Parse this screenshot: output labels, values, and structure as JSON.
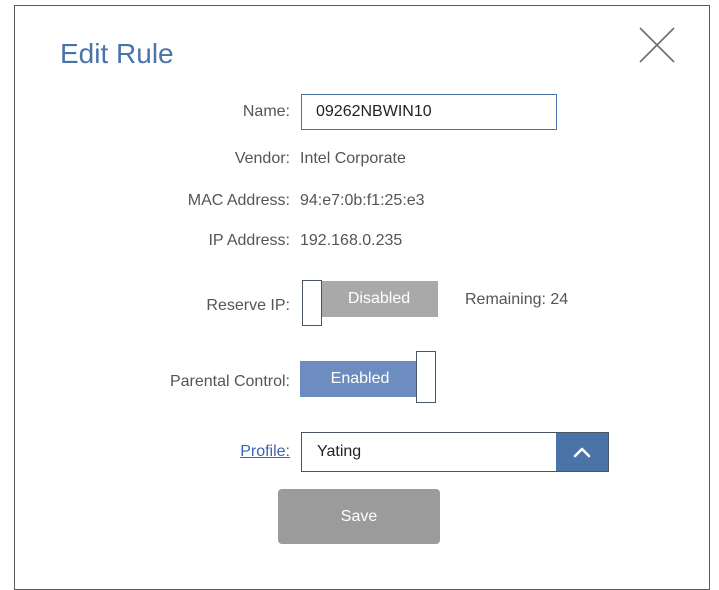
{
  "dialog": {
    "title": "Edit Rule"
  },
  "fields": {
    "name_label": "Name:",
    "name_value": "09262NBWIN10",
    "vendor_label": "Vendor:",
    "vendor_value": "Intel Corporate",
    "mac_label": "MAC Address:",
    "mac_value": "94:e7:0b:f1:25:e3",
    "ip_label": "IP Address:",
    "ip_value": "192.168.0.235",
    "reserve_label": "Reserve IP:",
    "reserve_state": "Disabled",
    "remaining_text": "Remaining: 24",
    "parental_label": "Parental Control:",
    "parental_state": "Enabled",
    "profile_label": "Profile",
    "profile_colon": ":",
    "profile_value": "Yating"
  },
  "actions": {
    "save_label": "Save"
  },
  "icons": {
    "close": "close-icon",
    "dropdown": "chevron-up-icon"
  },
  "colors": {
    "accent": "#4a74a8",
    "enabled": "#6d8dc1",
    "disabled": "#a9a9a9",
    "save_button": "#9b9b9b",
    "link": "#3b66b0"
  }
}
